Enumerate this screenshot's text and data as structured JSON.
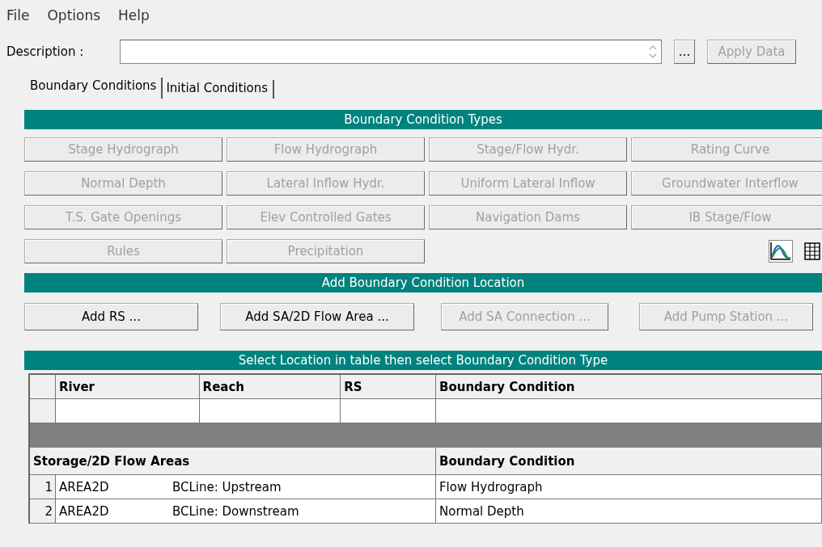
{
  "menu": [
    "File",
    "Options",
    "Help"
  ],
  "description": {
    "label": "Description :",
    "ellipsis_button": "...",
    "apply_button": {
      "label": "Apply Data",
      "disabled": true
    }
  },
  "tabs": [
    {
      "label": "Boundary Conditions",
      "selected": true
    },
    {
      "label": "Initial Conditions",
      "selected": false
    }
  ],
  "bc_types": {
    "title": "Boundary Condition Types",
    "buttons": [
      {
        "label": "Stage Hydrograph",
        "disabled": true
      },
      {
        "label": "Flow Hydrograph",
        "disabled": true
      },
      {
        "label": "Stage/Flow Hydr.",
        "disabled": true
      },
      {
        "label": "Rating Curve",
        "disabled": true
      },
      {
        "label": "Normal Depth",
        "disabled": true
      },
      {
        "label": "Lateral Inflow Hydr.",
        "disabled": true
      },
      {
        "label": "Uniform Lateral Inflow",
        "disabled": true
      },
      {
        "label": "Groundwater Interflow",
        "disabled": true
      },
      {
        "label": "T.S. Gate Openings",
        "disabled": true
      },
      {
        "label": "Elev Controlled Gates",
        "disabled": true
      },
      {
        "label": "Navigation Dams",
        "disabled": true
      },
      {
        "label": "IB Stage/Flow",
        "disabled": true
      },
      {
        "label": "Rules",
        "disabled": true
      },
      {
        "label": "Precipitation",
        "disabled": true
      }
    ]
  },
  "location": {
    "title": "Add Boundary Condition Location",
    "buttons": [
      {
        "label": "Add RS ...",
        "disabled": false
      },
      {
        "label": "Add SA/2D Flow Area ...",
        "disabled": false
      },
      {
        "label": "Add SA Connection ...",
        "disabled": true
      },
      {
        "label": "Add Pump Station ...",
        "disabled": true
      }
    ]
  },
  "table": {
    "title": "Select Location in table then select Boundary Condition Type",
    "columns": [
      "River",
      "Reach",
      "RS",
      "Boundary Condition"
    ],
    "storage_header": "Storage/2D Flow Areas",
    "storage_bc_header": "Boundary Condition",
    "storage_rows": [
      {
        "index": "1",
        "area": "AREA2D",
        "bc_line": "BCLine: Upstream",
        "condition": "Flow Hydrograph"
      },
      {
        "index": "2",
        "area": "AREA2D",
        "bc_line": "BCLine: Downstream",
        "condition": "Normal Depth"
      }
    ]
  }
}
